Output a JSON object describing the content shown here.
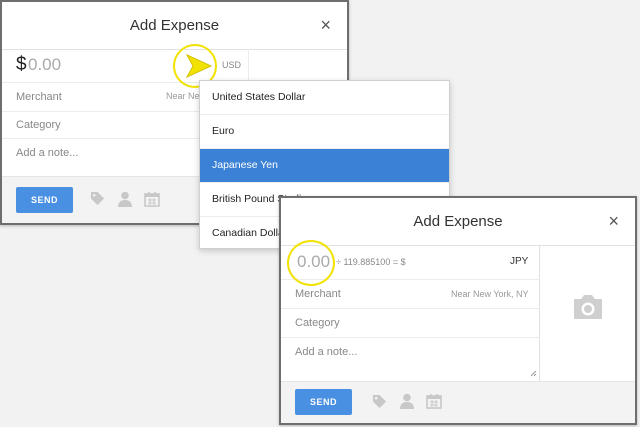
{
  "dialog1": {
    "title": "Add Expense",
    "close": "×",
    "currency_symbol": "$",
    "amount_placeholder": "0.00",
    "currency_code": "USD",
    "merchant_label": "Merchant",
    "merchant_location": "Near New",
    "category_label": "Category",
    "note_placeholder": "Add a note...",
    "send_label": "SEND"
  },
  "currency_menu": {
    "items": [
      {
        "label": "United States Dollar"
      },
      {
        "label": "Euro"
      },
      {
        "label": "Japanese Yen",
        "selected": true
      },
      {
        "label": "British Pound Sterling"
      },
      {
        "label": "Canadian Dollar"
      }
    ]
  },
  "dialog2": {
    "title": "Add Expense",
    "close": "×",
    "amount_placeholder": "0.00",
    "conversion": "÷ 119.885100 = $",
    "currency_code": "JPY",
    "merchant_label": "Merchant",
    "merchant_location": "Near New York, NY",
    "category_label": "Category",
    "note_placeholder": "Add a note...",
    "send_label": "SEND"
  },
  "icons": [
    "tag-icon",
    "person-icon",
    "calendar-icon",
    "camera-icon",
    "pointer-arrow-icon"
  ],
  "colors": {
    "accent": "#4a90e2",
    "selected": "#3b82d6",
    "highlight": "#f2e200"
  }
}
